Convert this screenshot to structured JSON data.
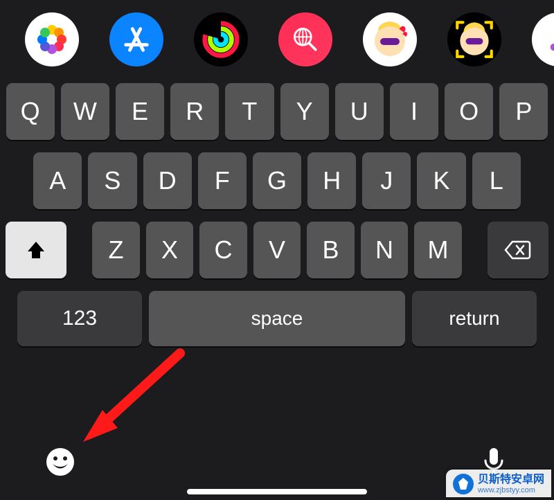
{
  "tray": {
    "items": [
      {
        "name": "photos-icon"
      },
      {
        "name": "app-store-icon"
      },
      {
        "name": "activity-rings-icon"
      },
      {
        "name": "search-web-icon"
      },
      {
        "name": "memoji-hearts-icon"
      },
      {
        "name": "memoji-scan-icon"
      },
      {
        "name": "music-icon"
      }
    ]
  },
  "keyboard": {
    "row1": [
      "Q",
      "W",
      "E",
      "R",
      "T",
      "Y",
      "U",
      "I",
      "O",
      "P"
    ],
    "row2": [
      "A",
      "S",
      "D",
      "F",
      "G",
      "H",
      "J",
      "K",
      "L"
    ],
    "row3": [
      "Z",
      "X",
      "C",
      "V",
      "B",
      "N",
      "M"
    ],
    "num_label": "123",
    "space_label": "space",
    "return_label": "return"
  },
  "bottom": {
    "emoji_btn": "emoji-keyboard-button",
    "mic_btn": "dictation-button"
  },
  "annotation": {
    "arrow_target": "emoji-keyboard-button"
  },
  "watermark": {
    "line1": "贝斯特安卓网",
    "line2": "www.zjbstyy.com"
  }
}
